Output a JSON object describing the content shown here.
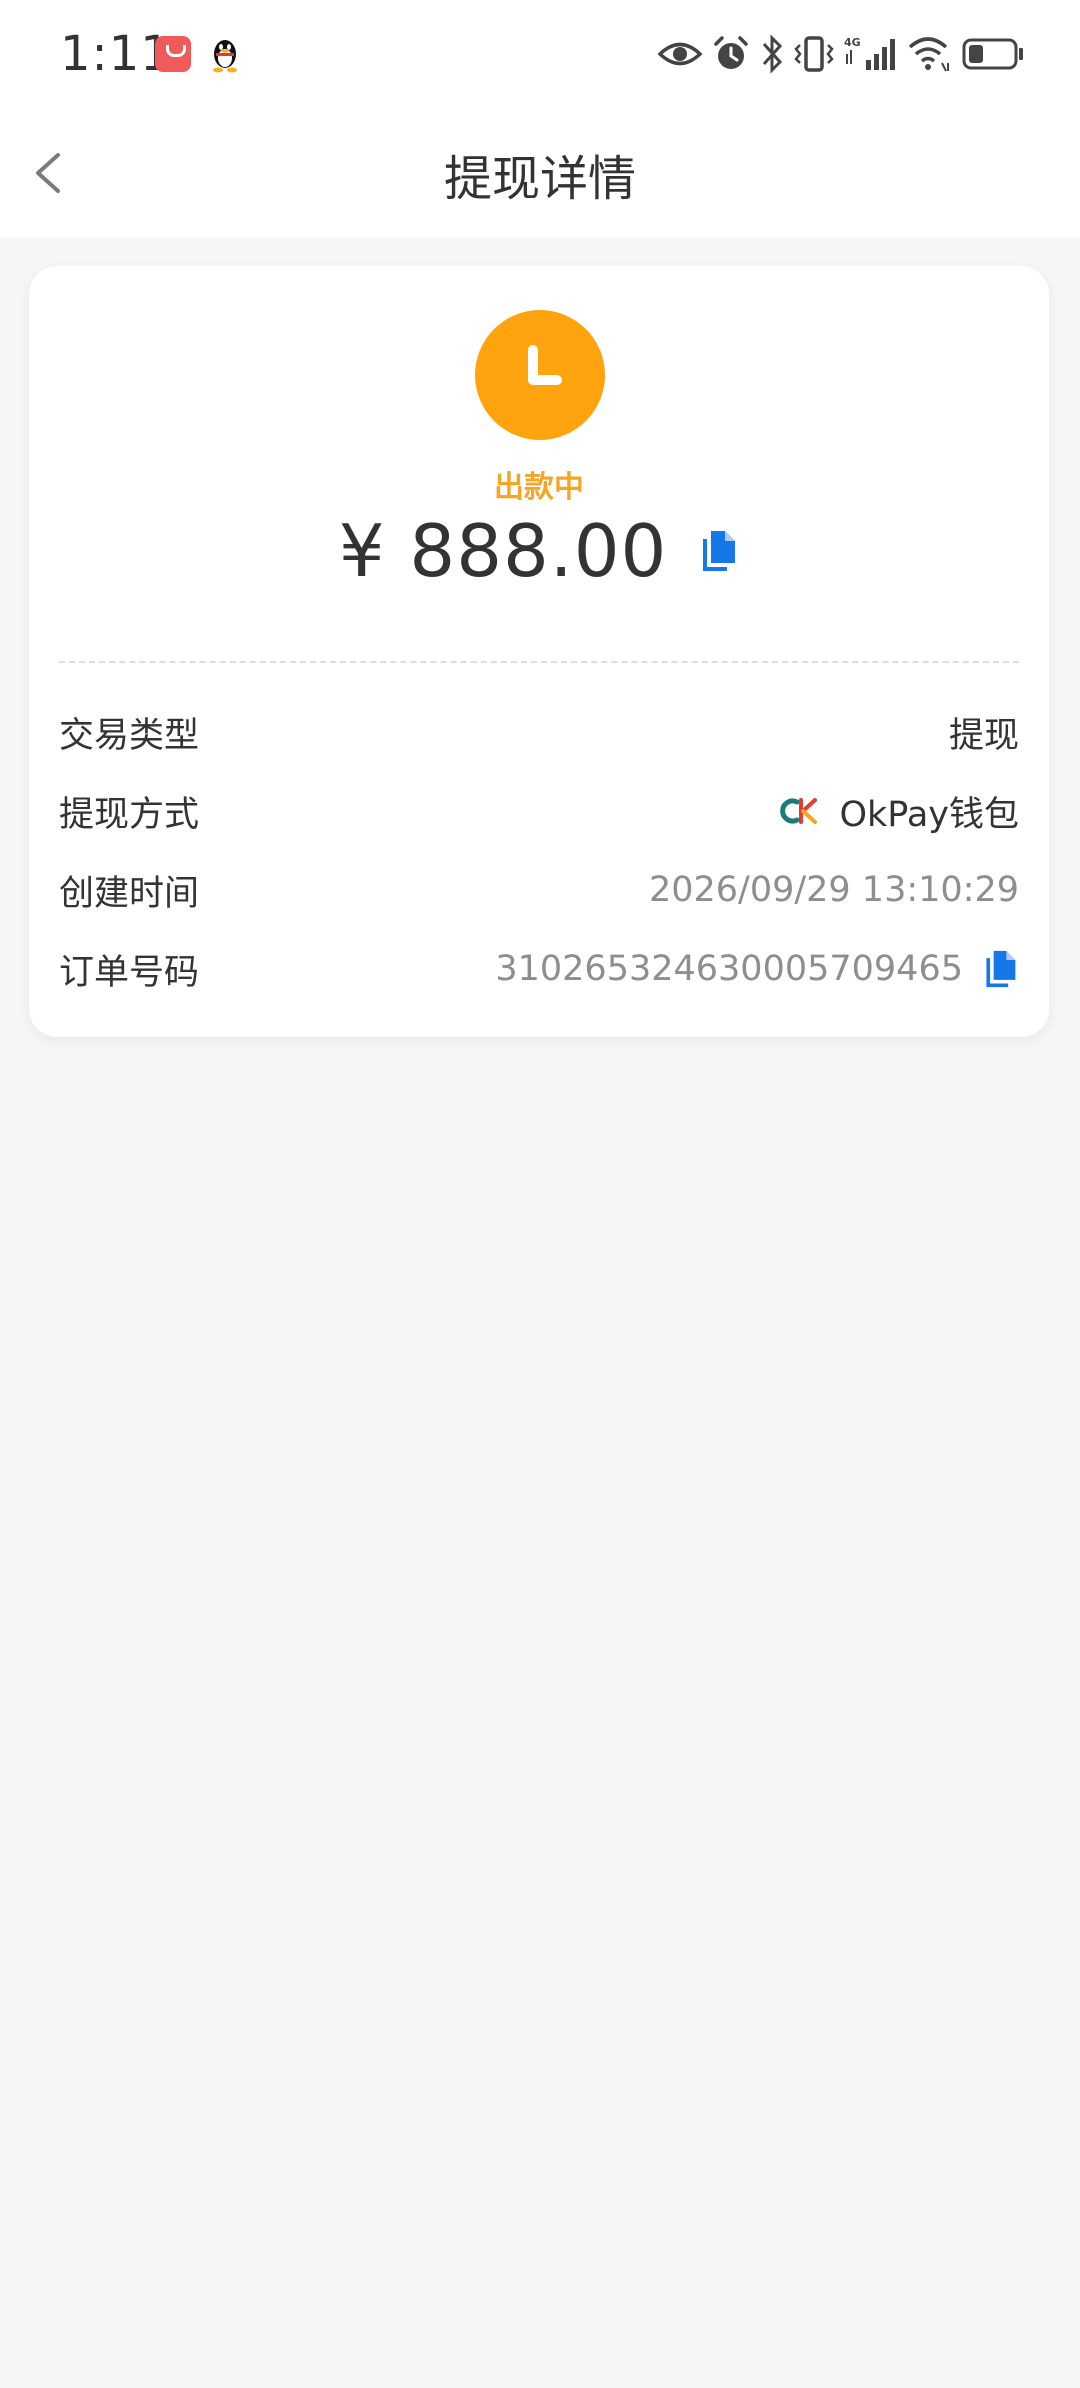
{
  "status_bar": {
    "time": "1:11",
    "icons": [
      "shopping-bag-icon",
      "qq-icon",
      "eye-icon",
      "alarm-icon",
      "bluetooth-icon",
      "vibrate-icon",
      "signal-4g-icon",
      "wifi-icon",
      "battery-icon"
    ],
    "battery_level": 0.3
  },
  "nav": {
    "title": "提现详情",
    "back_icon": "chevron-left-icon"
  },
  "summary": {
    "status": "出款中",
    "status_color": "#ffa40e",
    "amount": "¥ 888.00"
  },
  "details": {
    "type": {
      "label": "交易类型",
      "value": "提现"
    },
    "method": {
      "label": "提现方式",
      "value": "OkPay钱包"
    },
    "created": {
      "label": "创建时间",
      "value": "2026/09/29 13:10:29"
    },
    "order": {
      "label": "订单号码",
      "value": "31026532463000570946​5"
    }
  },
  "colors": {
    "accent_blue": "#1677e8",
    "status_orange": "#ffa40e",
    "background": "#f6f6f6"
  }
}
